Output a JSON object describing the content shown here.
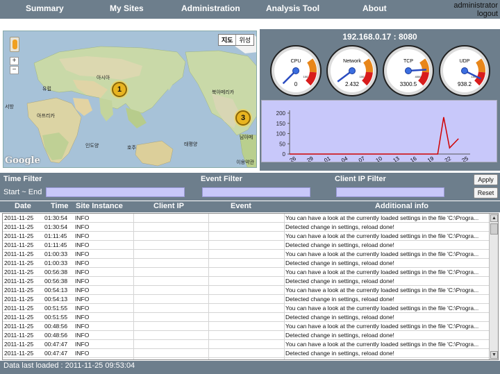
{
  "nav": {
    "summary": "Summary",
    "my_sites": "My Sites",
    "administration": "Administration",
    "analysis_tool": "Analysis Tool",
    "about": "About"
  },
  "user": {
    "name": "administrator",
    "logout": "logout"
  },
  "map": {
    "type_map": "지도",
    "type_satellite": "위성",
    "zoom_in": "+",
    "zoom_out": "−",
    "labels": {
      "asia": "아시아",
      "europe": "유럽",
      "africa": "아프리카",
      "north_america": "북아메리카",
      "south_america": "남아메",
      "indian_ocean": "인도양",
      "australia": "호주",
      "pacific": "태평양",
      "west": "서방"
    },
    "markers": [
      {
        "label": "1"
      },
      {
        "label": "3"
      }
    ],
    "logo": "Google",
    "terms": "이용약관"
  },
  "server": {
    "address": "192.168.0.17 : 8080"
  },
  "gauges": [
    {
      "name": "CPU",
      "value": "0",
      "scale_max": "100",
      "fraction": 0.0
    },
    {
      "name": "Network",
      "value": "2.432",
      "scale_max": "100",
      "fraction": 0.03
    },
    {
      "name": "TCP",
      "value": "3300.5",
      "scale_max": "4000",
      "fraction": 0.82
    },
    {
      "name": "UDP",
      "value": "938.2",
      "scale_max": "1000",
      "fraction": 0.93
    }
  ],
  "chart_data": {
    "type": "line",
    "categories": [
      "26",
      "29",
      "01",
      "04",
      "07",
      "10",
      "13",
      "16",
      "19",
      "22",
      "25"
    ],
    "x_label_color": "#000000",
    "yticks": [
      "0",
      "50",
      "100",
      "150",
      "200"
    ],
    "ylim": [
      0,
      200
    ],
    "x_range": [
      26,
      56
    ],
    "grid": false,
    "series": [
      {
        "color": "#d00000",
        "points": [
          [
            26,
            0
          ],
          [
            29,
            0
          ],
          [
            32,
            0
          ],
          [
            35,
            0
          ],
          [
            38,
            0
          ],
          [
            41,
            0
          ],
          [
            44,
            0
          ],
          [
            47,
            0
          ],
          [
            50,
            0
          ],
          [
            51,
            0
          ],
          [
            52,
            180
          ],
          [
            53,
            30
          ],
          [
            54.5,
            75
          ]
        ]
      }
    ]
  },
  "filters": {
    "time_title": "Time Filter",
    "time_sub": "Start ~ End",
    "event_title": "Event Filter",
    "client_ip_title": "Client IP Filter",
    "apply": "Apply",
    "reset": "Reset"
  },
  "table": {
    "headers": {
      "date": "Date",
      "time": "Time",
      "site_instance": "Site Instance",
      "client_ip": "Client IP",
      "event": "Event",
      "additional_info": "Additional info"
    },
    "rows": [
      {
        "date": "2011-11-25",
        "time": "01:30:54",
        "site": "INFO",
        "ip": "",
        "event": "",
        "info": "You can have a look at the currently loaded settings in the file 'C:\\Progra..."
      },
      {
        "date": "2011-11-25",
        "time": "01:30:54",
        "site": "INFO",
        "ip": "",
        "event": "",
        "info": "Detected change in settings, reload done!"
      },
      {
        "date": "2011-11-25",
        "time": "01:11:45",
        "site": "INFO",
        "ip": "",
        "event": "",
        "info": "You can have a look at the currently loaded settings in the file 'C:\\Progra..."
      },
      {
        "date": "2011-11-25",
        "time": "01:11:45",
        "site": "INFO",
        "ip": "",
        "event": "",
        "info": "Detected change in settings, reload done!"
      },
      {
        "date": "2011-11-25",
        "time": "01:00:33",
        "site": "INFO",
        "ip": "",
        "event": "",
        "info": "You can have a look at the currently loaded settings in the file 'C:\\Progra..."
      },
      {
        "date": "2011-11-25",
        "time": "01:00:33",
        "site": "INFO",
        "ip": "",
        "event": "",
        "info": "Detected change in settings, reload done!"
      },
      {
        "date": "2011-11-25",
        "time": "00:56:38",
        "site": "INFO",
        "ip": "",
        "event": "",
        "info": "You can have a look at the currently loaded settings in the file 'C:\\Progra..."
      },
      {
        "date": "2011-11-25",
        "time": "00:56:38",
        "site": "INFO",
        "ip": "",
        "event": "",
        "info": "Detected change in settings, reload done!"
      },
      {
        "date": "2011-11-25",
        "time": "00:54:13",
        "site": "INFO",
        "ip": "",
        "event": "",
        "info": "You can have a look at the currently loaded settings in the file 'C:\\Progra..."
      },
      {
        "date": "2011-11-25",
        "time": "00:54:13",
        "site": "INFO",
        "ip": "",
        "event": "",
        "info": "Detected change in settings, reload done!"
      },
      {
        "date": "2011-11-25",
        "time": "00:51:55",
        "site": "INFO",
        "ip": "",
        "event": "",
        "info": "You can have a look at the currently loaded settings in the file 'C:\\Progra..."
      },
      {
        "date": "2011-11-25",
        "time": "00:51:55",
        "site": "INFO",
        "ip": "",
        "event": "",
        "info": "Detected change in settings, reload done!"
      },
      {
        "date": "2011-11-25",
        "time": "00:48:56",
        "site": "INFO",
        "ip": "",
        "event": "",
        "info": "You can have a look at the currently loaded settings in the file 'C:\\Progra..."
      },
      {
        "date": "2011-11-25",
        "time": "00:48:56",
        "site": "INFO",
        "ip": "",
        "event": "",
        "info": "Detected change in settings, reload done!"
      },
      {
        "date": "2011-11-25",
        "time": "00:47:47",
        "site": "INFO",
        "ip": "",
        "event": "",
        "info": "You can have a look at the currently loaded settings in the file 'C:\\Progra..."
      },
      {
        "date": "2011-11-25",
        "time": "00:47:47",
        "site": "INFO",
        "ip": "",
        "event": "",
        "info": "Detected change in settings, reload done!"
      }
    ]
  },
  "footer": {
    "status": "Data last loaded : 2011-11-25 09:53:04"
  },
  "colors": {
    "bar_bg": "#6d7e8c",
    "input_bg": "#c8c8fa",
    "chart_line": "#d00000",
    "marker": "#e8b420"
  }
}
